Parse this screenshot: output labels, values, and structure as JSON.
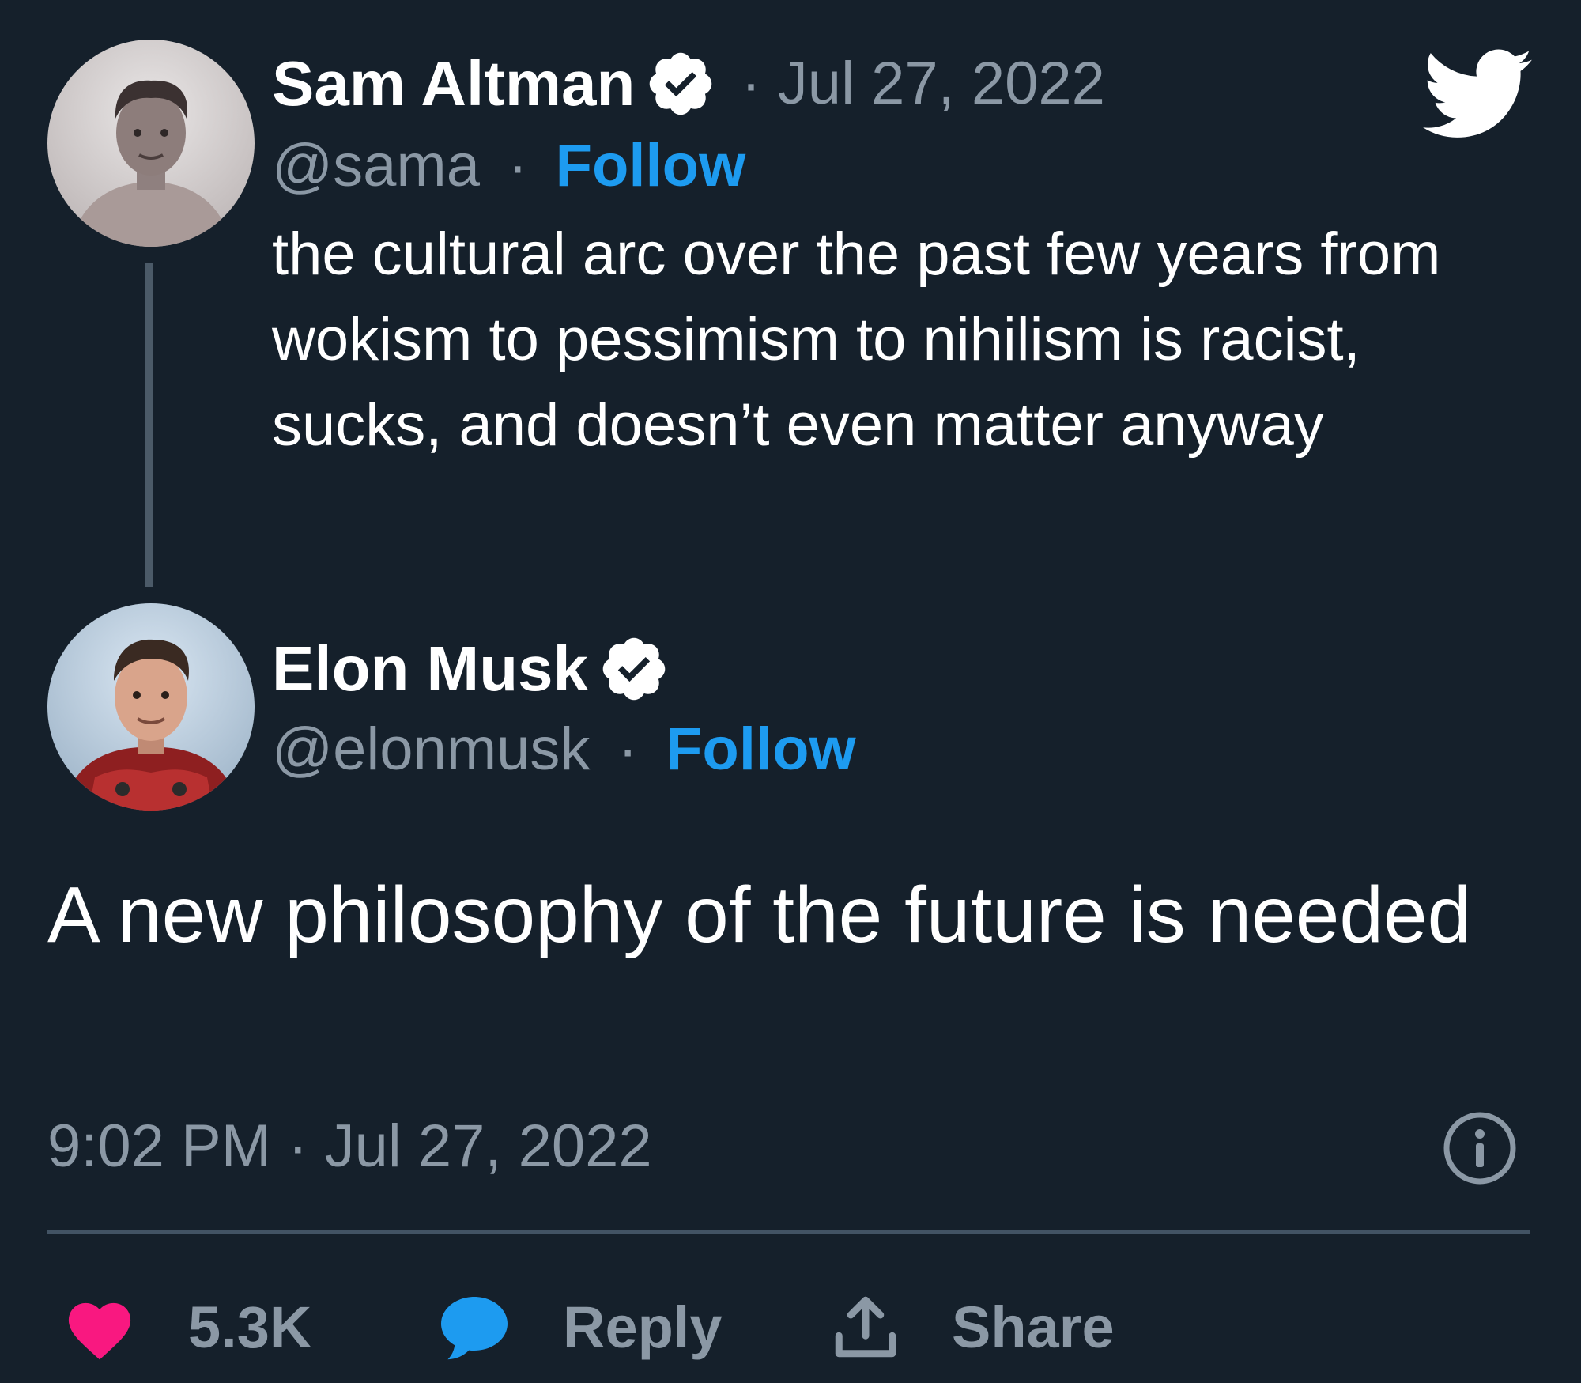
{
  "tweet_original": {
    "author_name": "Sam Altman",
    "date": "· Jul 27, 2022",
    "handle": "@sama",
    "separator": "·",
    "follow_label": "Follow",
    "text": "the cultural arc over the past few years from wokism to pessimism to nihilism is racist, sucks, and doesn’t even matter anyway"
  },
  "tweet_reply": {
    "author_name": "Elon Musk",
    "handle": "@elonmusk",
    "separator": "·",
    "follow_label": "Follow",
    "text": "A new philosophy of the future is needed",
    "timestamp": "9:02 PM · Jul 27, 2022"
  },
  "actions": {
    "like_count": "5.3K",
    "reply_label": "Reply",
    "share_label": "Share"
  },
  "colors": {
    "background": "#15202b",
    "link_blue": "#1d9bf0",
    "muted_text": "#8b98a5",
    "like_pink": "#f91880",
    "reply_blue": "#1d9bf0"
  },
  "icons": {
    "brand": "twitter-bird-icon",
    "verified": "verified-badge-icon",
    "info": "info-icon",
    "like": "heart-icon",
    "reply": "speech-bubble-icon",
    "share": "upload-share-icon"
  }
}
